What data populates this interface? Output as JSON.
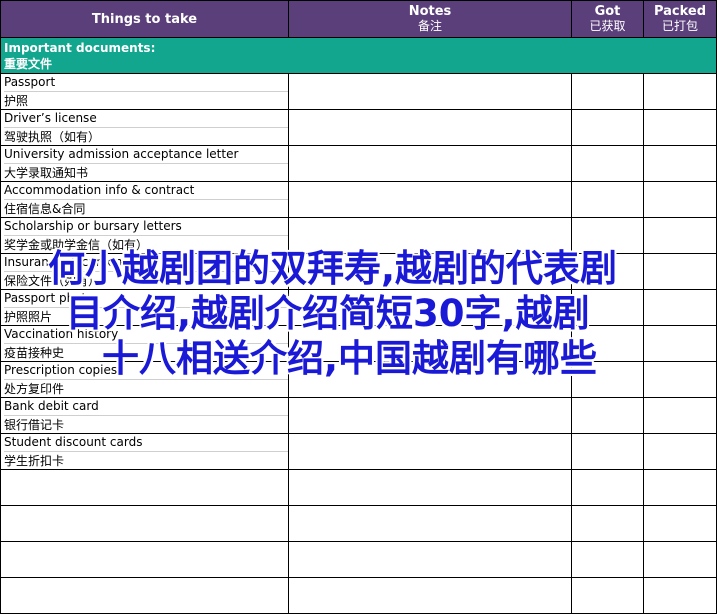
{
  "headers": {
    "things": "Things to take",
    "notes_en": "Notes",
    "notes_zh": "备注",
    "got_en": "Got",
    "got_zh": "已获取",
    "packed_en": "Packed",
    "packed_zh": "已打包"
  },
  "section": {
    "en": "Important documents:",
    "zh": "重要文件"
  },
  "items": [
    {
      "en": "Passport",
      "zh": "护照"
    },
    {
      "en": "Driver’s license",
      "zh": "驾驶执照（如有）"
    },
    {
      "en": "University admission acceptance letter",
      "zh": "大学录取通知书"
    },
    {
      "en": "Accommodation info & contract",
      "zh": "住宿信息&合同"
    },
    {
      "en": "Scholarship or bursary letters",
      "zh": "奖学金或助学金信（如有）"
    },
    {
      "en": "Insurance documents",
      "zh": "保险文件（如有）"
    },
    {
      "en": "Passport photos",
      "zh": "护照照片"
    },
    {
      "en": "Vaccination history",
      "zh": "疫苗接种史"
    },
    {
      "en": "Prescription copies",
      "zh": "处方复印件"
    },
    {
      "en": "Bank debit card",
      "zh": "银行借记卡"
    },
    {
      "en": "Student discount cards",
      "zh": "学生折扣卡"
    }
  ],
  "overlay": {
    "line1": "何小越剧团的双拜寿,越剧的代表剧",
    "line2": "目介绍,越剧介绍简短30字,越剧",
    "line3": "十八相送介绍,中国越剧有哪些"
  }
}
